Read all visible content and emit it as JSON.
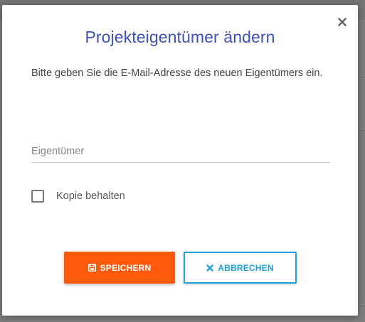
{
  "dialog": {
    "title": "Projekteigentümer ändern",
    "description": "Bitte geben Sie die E-Mail-Adresse des neuen Eigentümers ein.",
    "close_icon": "close-icon"
  },
  "owner_field": {
    "placeholder": "Eigentümer",
    "value": ""
  },
  "keep_copy": {
    "label": "Kopie behalten",
    "checked": false
  },
  "buttons": {
    "save": {
      "label": "SPEICHERN",
      "icon": "save-icon"
    },
    "cancel": {
      "label": "ABBRECHEN",
      "icon": "x-icon"
    }
  },
  "colors": {
    "title": "#3f51b5",
    "save_bg": "#ff5a0c",
    "cancel_accent": "#1fa0d8",
    "backdrop": "#7d7d7d"
  }
}
